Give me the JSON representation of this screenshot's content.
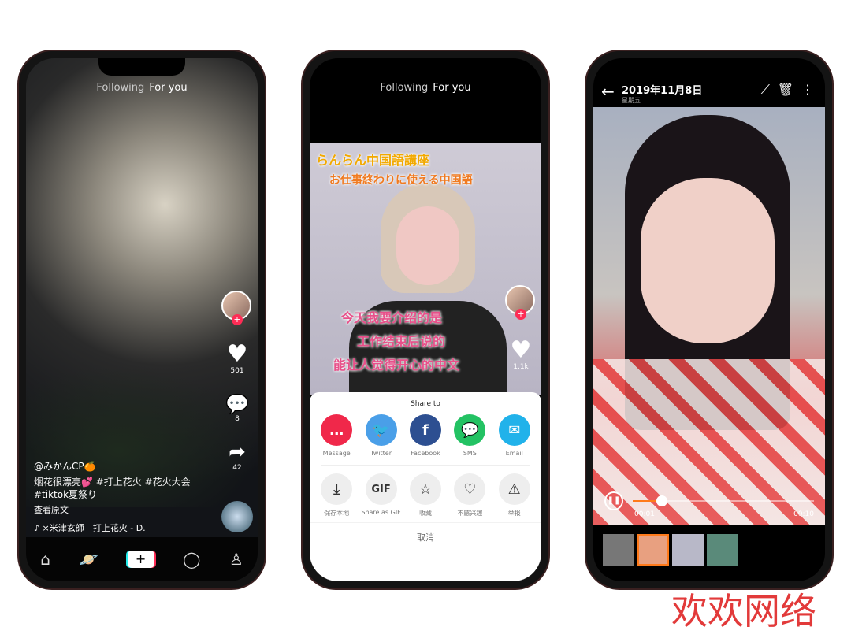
{
  "phone1": {
    "nav": {
      "following": "Following",
      "for_you": "For you"
    },
    "likes": "501",
    "comments": "8",
    "shares": "42",
    "username": "@みかんCP🍊",
    "caption": "烟花很漂亮💕 #打上花火 #花火大会",
    "caption2": "#tiktok夏祭り",
    "see_original": "查看原文",
    "music": "♪ ×米津玄師　打上花火 - D.",
    "bottom_nav": {
      "home": "home-icon",
      "discover": "planet-icon",
      "create": "+",
      "inbox": "message-icon",
      "me": "profile-icon"
    }
  },
  "phone2": {
    "nav": {
      "following": "Following",
      "for_you": "For you"
    },
    "subtitle_top1": "らんらん中国語講座",
    "subtitle_top2": "お仕事終わりに使える中国語",
    "subtitle_bottom": [
      "今天我要介绍的是",
      "工作结束后说的",
      "能让人觉得开心的中文"
    ],
    "likes": "1.1k",
    "share_sheet": {
      "title": "Share to",
      "targets": [
        {
          "label": "Message",
          "icon": "message-icon",
          "color": "#f0284a"
        },
        {
          "label": "Twitter",
          "icon": "twitter-icon",
          "color": "#4a9fe8"
        },
        {
          "label": "Facebook",
          "icon": "facebook-icon",
          "color": "#2d4f91"
        },
        {
          "label": "SMS",
          "icon": "sms-icon",
          "color": "#23c263"
        },
        {
          "label": "Email",
          "icon": "email-icon",
          "color": "#21b2ea"
        }
      ],
      "actions": [
        {
          "label": "保存本地",
          "icon": "download-icon"
        },
        {
          "label": "Share as GIF",
          "icon": "gif-icon",
          "glyph": "GIF"
        },
        {
          "label": "收藏",
          "icon": "star-icon"
        },
        {
          "label": "不感兴趣",
          "icon": "broken-heart-icon"
        },
        {
          "label": "举报",
          "icon": "warning-icon"
        }
      ],
      "cancel": "取消"
    }
  },
  "phone3": {
    "date": "2019年11月8日",
    "weekday": "星期五",
    "current_time": "00:01",
    "duration": "00:10",
    "progress": 0.16,
    "accent": "#ff7a1a"
  },
  "watermark": "欢欢网络"
}
